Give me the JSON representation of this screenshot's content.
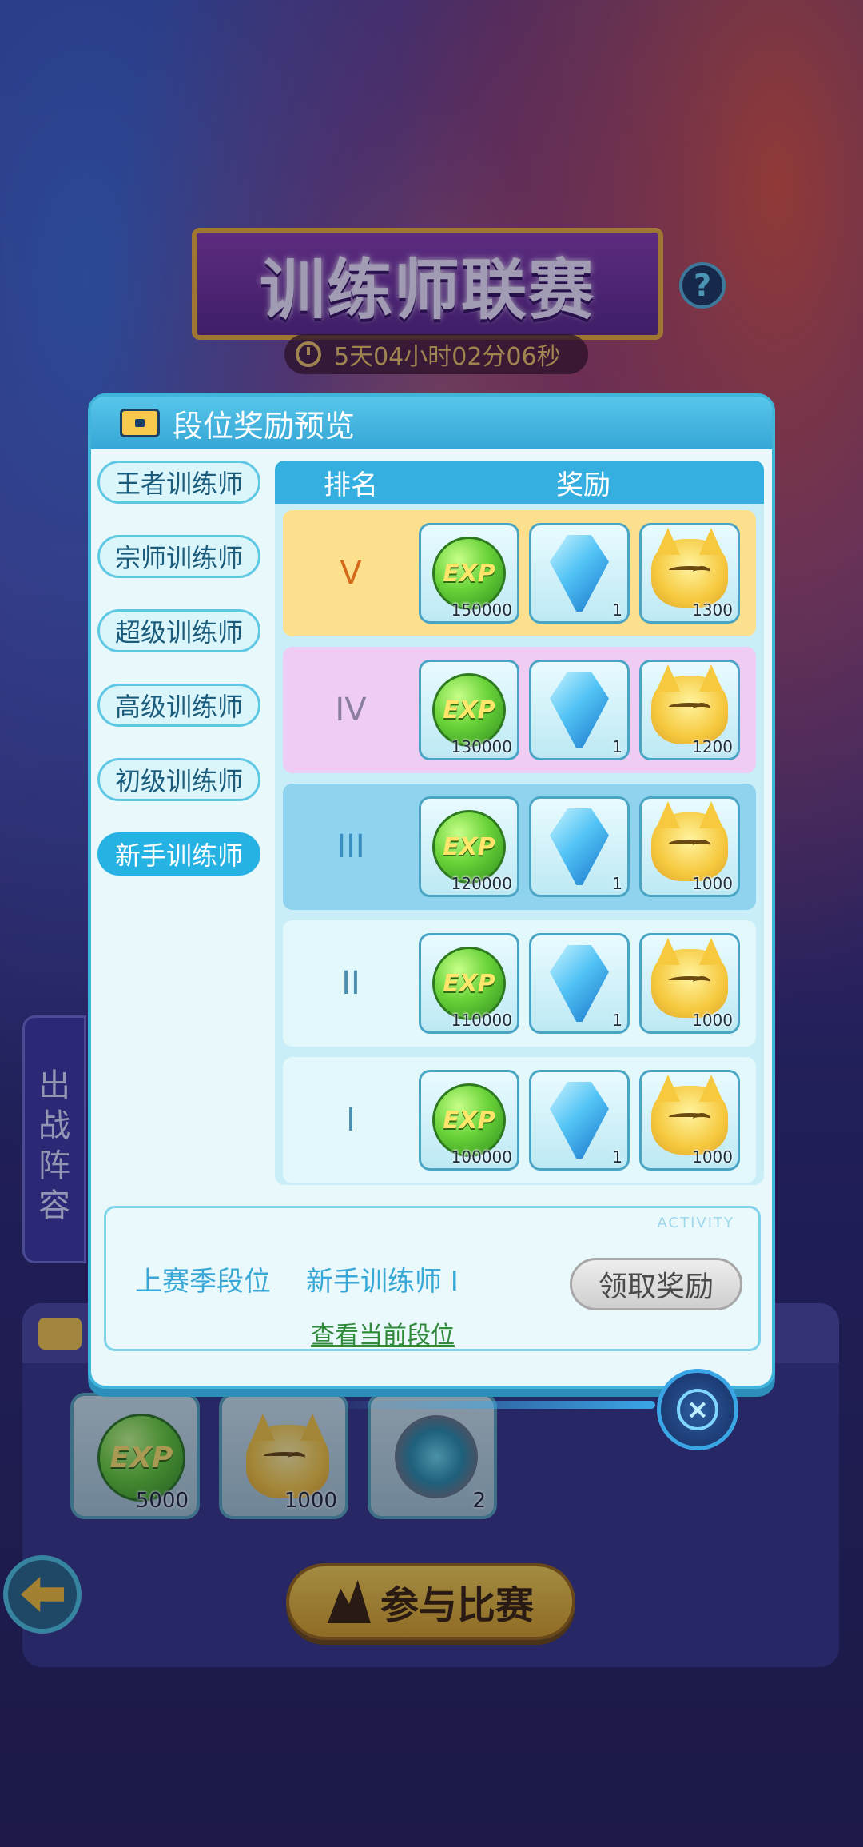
{
  "header": {
    "title": "训练师联赛",
    "help_label": "?",
    "timer": "5天04小时02分06秒"
  },
  "modal": {
    "title": "段位奖励预览",
    "tiers": [
      {
        "label": "王者训练师",
        "active": false
      },
      {
        "label": "宗师训练师",
        "active": false
      },
      {
        "label": "超级训练师",
        "active": false
      },
      {
        "label": "高级训练师",
        "active": false
      },
      {
        "label": "初级训练师",
        "active": false
      },
      {
        "label": "新手训练师",
        "active": true
      }
    ],
    "table": {
      "col_rank": "排名",
      "col_reward": "奖励",
      "rows": [
        {
          "rank": "V",
          "exp": "150000",
          "gem": "1",
          "cat": "1300"
        },
        {
          "rank": "IV",
          "exp": "130000",
          "gem": "1",
          "cat": "1200"
        },
        {
          "rank": "III",
          "exp": "120000",
          "gem": "1",
          "cat": "1000"
        },
        {
          "rank": "II",
          "exp": "110000",
          "gem": "1",
          "cat": "1000"
        },
        {
          "rank": "I",
          "exp": "100000",
          "gem": "1",
          "cat": "1000"
        }
      ]
    },
    "activity_tag": "ACTIVITY",
    "last_season_label": "上赛季段位",
    "last_season_value": "新手训练师 I",
    "claim_label": "领取奖励",
    "view_current_label": "查看当前段位",
    "close_label": "×"
  },
  "behind": {
    "formation_label": [
      "出",
      "战",
      "阵",
      "容"
    ],
    "rewards": [
      {
        "type": "exp",
        "count": "5000"
      },
      {
        "type": "cat",
        "count": "1000"
      },
      {
        "type": "energy",
        "count": "2"
      }
    ],
    "join_label": "参与比赛"
  }
}
